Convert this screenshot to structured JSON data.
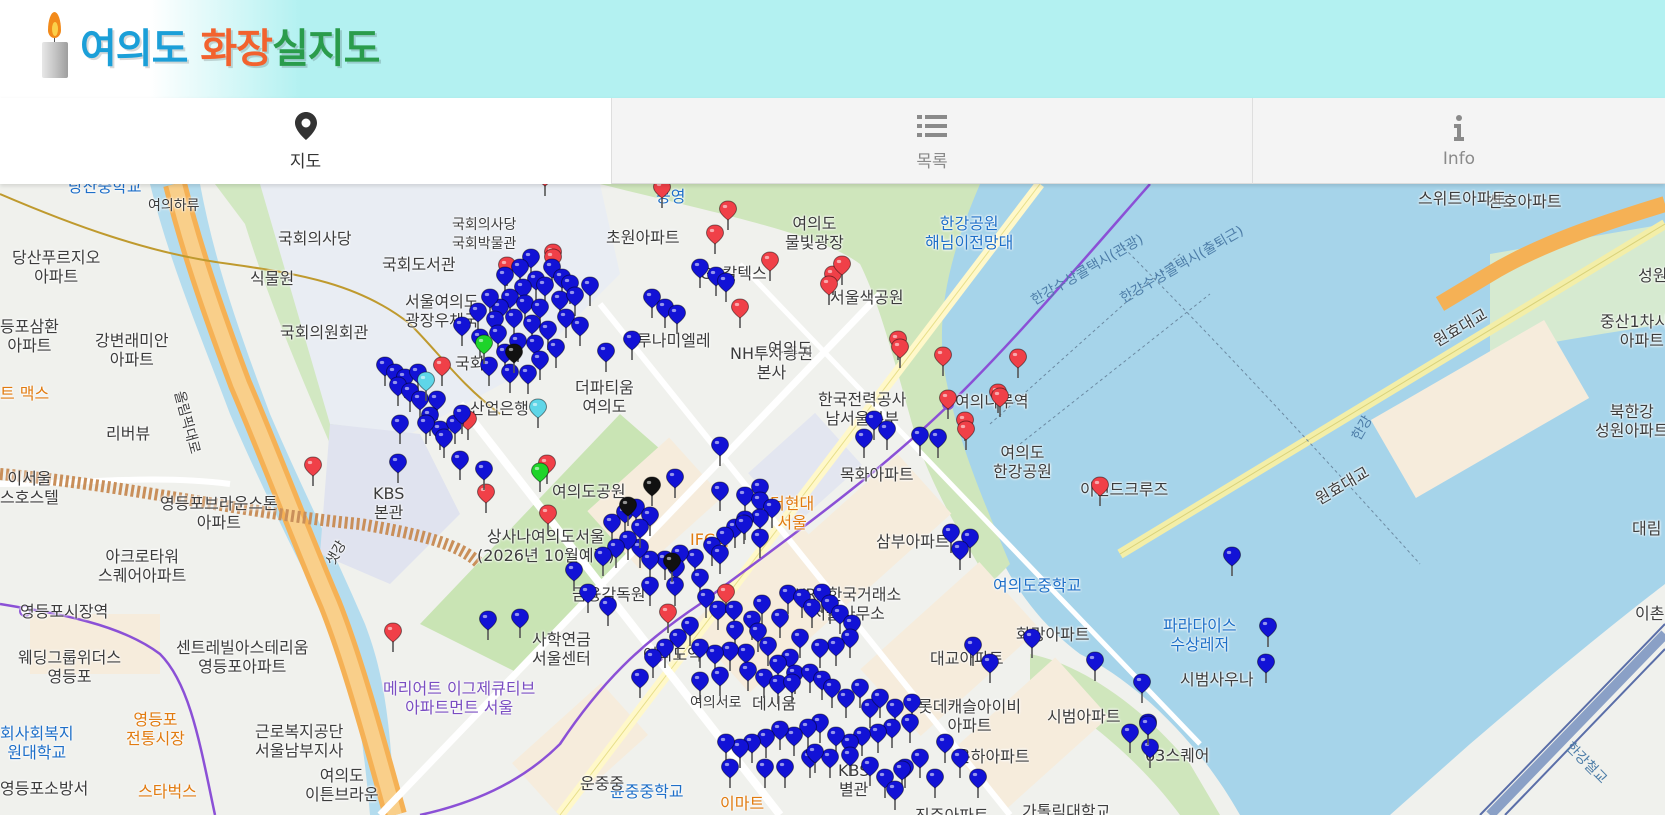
{
  "app": {
    "logo_part1": "여의도",
    "logo_part2": "화장",
    "logo_part3": "실",
    "logo_part4": "지도"
  },
  "tabs": [
    {
      "id": "map",
      "label": "지도",
      "icon": "map-marker-icon",
      "active": true
    },
    {
      "id": "list",
      "label": "목록",
      "icon": "list-icon",
      "active": false
    },
    {
      "id": "info",
      "label": "Info",
      "icon": "info-icon",
      "active": false
    }
  ],
  "colors": {
    "header_bg": "#b3f1f1",
    "pin_blue": "#1212d6",
    "pin_red": "#f04048",
    "pin_green": "#1ed42a",
    "pin_black": "#111111",
    "pin_cyan": "#5fd6e8",
    "water": "#a6d4ea",
    "park": "#cfe6bc"
  },
  "map_labels": [
    {
      "text": "당산중학교",
      "style": "blue"
    },
    {
      "text": "여의하류",
      "style": "sm"
    },
    {
      "text": "국회의사당",
      "style": ""
    },
    {
      "text": "국회의사당\n국회박물관",
      "style": "sm"
    },
    {
      "text": "당산푸르지오\n아파트",
      "style": ""
    },
    {
      "text": "식물원",
      "style": ""
    },
    {
      "text": "국회도서관",
      "style": ""
    },
    {
      "text": "등포삼환\n아파트",
      "style": ""
    },
    {
      "text": "강변래미안\n아파트",
      "style": ""
    },
    {
      "text": "국회의원회관",
      "style": ""
    },
    {
      "text": "서울여의도\n광장우체국",
      "style": ""
    },
    {
      "text": "초원아파트",
      "style": ""
    },
    {
      "text": "공영",
      "style": "blue"
    },
    {
      "text": "여의도\n물빛광장",
      "style": ""
    },
    {
      "text": "한강공원\n해님이전망대",
      "style": "blue"
    },
    {
      "text": "GS칼텍스",
      "style": ""
    },
    {
      "text": "서울색공원",
      "style": ""
    },
    {
      "text": "루나미엘레",
      "style": ""
    },
    {
      "text": "NH투자증권\n본사",
      "style": ""
    },
    {
      "text": "여의도",
      "style": ""
    },
    {
      "text": "한국전력공사\n남서울본부",
      "style": ""
    },
    {
      "text": "여의나루역",
      "style": ""
    },
    {
      "text": "한강수상콜택시(관광)",
      "style": "water"
    },
    {
      "text": "한강수상콜택시(출퇴근)",
      "style": "water"
    },
    {
      "text": "원효대교",
      "style": ""
    },
    {
      "text": "산호아파트",
      "style": ""
    },
    {
      "text": "중산1차시범\n아파트",
      "style": ""
    },
    {
      "text": "북한강\n성원아파트",
      "style": ""
    },
    {
      "text": "트 맥스",
      "style": "orange"
    },
    {
      "text": "리버뷰",
      "style": ""
    },
    {
      "text": "국회",
      "style": ""
    },
    {
      "text": "더파티움\n여의도",
      "style": ""
    },
    {
      "text": "산업은행",
      "style": ""
    },
    {
      "text": "목화아파트",
      "style": ""
    },
    {
      "text": "여의도\n한강공원",
      "style": ""
    },
    {
      "text": "이랜드크루즈",
      "style": ""
    },
    {
      "text": "원효대교",
      "style": ""
    },
    {
      "text": "이서울\n스호스텔",
      "style": ""
    },
    {
      "text": "영등포브라운스톤\n아파트",
      "style": ""
    },
    {
      "text": "KBS\n본관",
      "style": ""
    },
    {
      "text": "여의도공원",
      "style": ""
    },
    {
      "text": "더현대\n서울",
      "style": "orange"
    },
    {
      "text": "삼부아파트",
      "style": ""
    },
    {
      "text": "아크로타워\n스퀘어아파트",
      "style": ""
    },
    {
      "text": "IFC몰",
      "style": "orange"
    },
    {
      "text": "상사나여의도서울\n(2026년 10월예정)",
      "style": ""
    },
    {
      "text": "여의도중학교",
      "style": "blue"
    },
    {
      "text": "KRX한국거래소\n서울사무소",
      "style": ""
    },
    {
      "text": "금융감독원",
      "style": ""
    },
    {
      "text": "영등포시장역",
      "style": ""
    },
    {
      "text": "파라다이스\n수상레저",
      "style": "blue"
    },
    {
      "text": "화랑아파트",
      "style": ""
    },
    {
      "text": "웨딩그룹위더스\n영등포",
      "style": ""
    },
    {
      "text": "센트레빌아스테리움\n영등포아파트",
      "style": ""
    },
    {
      "text": "사학연금\n서울센터",
      "style": ""
    },
    {
      "text": "여의도역",
      "style": ""
    },
    {
      "text": "대교아파트",
      "style": ""
    },
    {
      "text": "시범사우나",
      "style": ""
    },
    {
      "text": "메리어트 이그제큐티브\n아파트먼트 서울",
      "style": "purple"
    },
    {
      "text": "롯데캐슬아이비\n아파트",
      "style": ""
    },
    {
      "text": "시범아파트",
      "style": ""
    },
    {
      "text": "영등포\n전통시장",
      "style": "orange"
    },
    {
      "text": "근로복지공단\n서울남부지사",
      "style": ""
    },
    {
      "text": "은하아파트",
      "style": ""
    },
    {
      "text": "63스퀘어",
      "style": ""
    },
    {
      "text": "회사회복지\n원대학교",
      "style": "blue"
    },
    {
      "text": "스타벅스",
      "style": "orange"
    },
    {
      "text": "여의도\n이튼브라운",
      "style": ""
    },
    {
      "text": "영등포소방서",
      "style": ""
    },
    {
      "text": "윤중중학교",
      "style": "blue"
    },
    {
      "text": "이마트",
      "style": "orange"
    },
    {
      "text": "가톨릭대학교",
      "style": ""
    },
    {
      "text": "KBS\n별관",
      "style": ""
    },
    {
      "text": "진주아파트",
      "style": ""
    },
    {
      "text": "데시움",
      "style": ""
    },
    {
      "text": "올림픽대로",
      "style": "sm"
    },
    {
      "text": "한강",
      "style": "water"
    },
    {
      "text": "스위트아파트",
      "style": ""
    },
    {
      "text": "성원",
      "style": ""
    },
    {
      "text": "대림",
      "style": ""
    },
    {
      "text": "이촌",
      "style": ""
    },
    {
      "text": "한강철교",
      "style": "water"
    },
    {
      "text": "운중중",
      "style": ""
    },
    {
      "text": "여의서로",
      "style": "sm"
    },
    {
      "text": "샛강",
      "style": "sm"
    }
  ]
}
